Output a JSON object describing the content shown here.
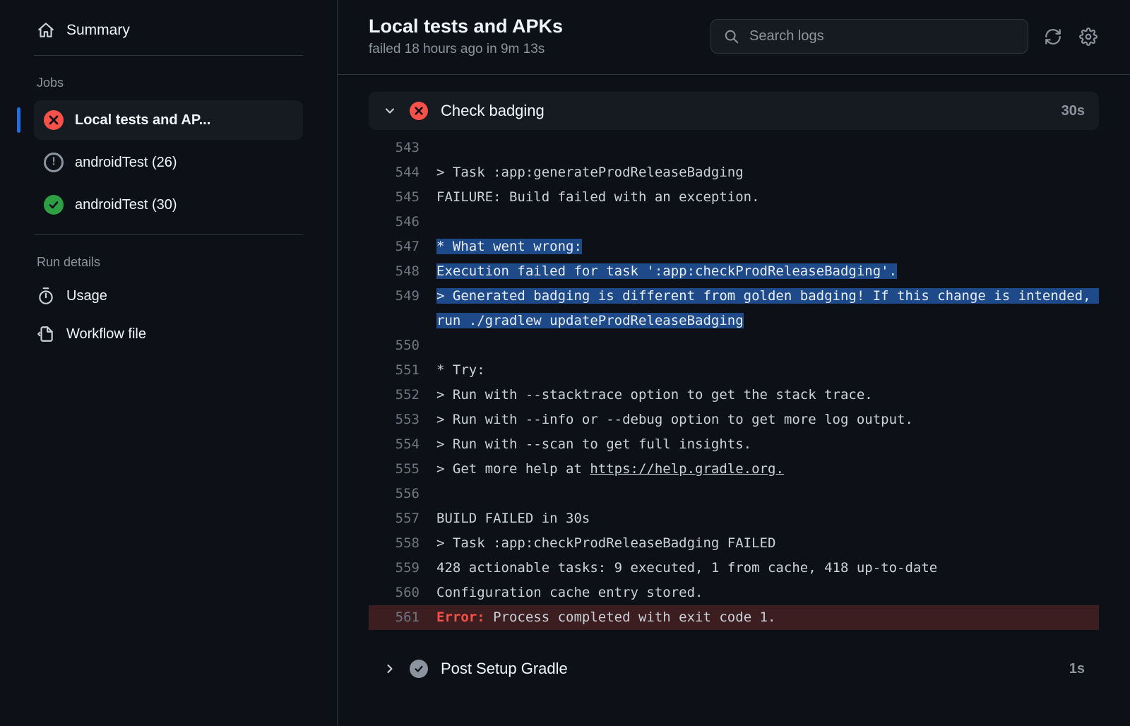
{
  "sidebar": {
    "summary_label": "Summary",
    "jobs_header": "Jobs",
    "jobs": [
      {
        "label": "Local tests and AP...",
        "status": "fail",
        "active": true
      },
      {
        "label": "androidTest (26)",
        "status": "pending",
        "active": false
      },
      {
        "label": "androidTest (30)",
        "status": "pass",
        "active": false
      }
    ],
    "run_details_header": "Run details",
    "run_details": [
      {
        "label": "Usage"
      },
      {
        "label": "Workflow file"
      }
    ]
  },
  "header": {
    "title": "Local tests and APKs",
    "subtitle": "failed 18 hours ago in 9m 13s"
  },
  "search": {
    "placeholder": "Search logs"
  },
  "step_expanded": {
    "name": "Check badging",
    "duration": "30s"
  },
  "log_lines": [
    {
      "n": "543",
      "t": ""
    },
    {
      "n": "544",
      "t": "> Task :app:generateProdReleaseBadging"
    },
    {
      "n": "545",
      "t": "FAILURE: Build failed with an exception."
    },
    {
      "n": "546",
      "t": ""
    },
    {
      "n": "547",
      "t": "* What went wrong:",
      "sel": true
    },
    {
      "n": "548",
      "t": "Execution failed for task ':app:checkProdReleaseBadging'.",
      "sel": true
    },
    {
      "n": "549",
      "t": "> Generated badging is different from golden badging! If this change is intended, run ./gradlew updateProdReleaseBadging",
      "sel": true
    },
    {
      "n": "550",
      "t": ""
    },
    {
      "n": "551",
      "t": "* Try:"
    },
    {
      "n": "552",
      "t": "> Run with --stacktrace option to get the stack trace."
    },
    {
      "n": "553",
      "t": "> Run with --info or --debug option to get more log output."
    },
    {
      "n": "554",
      "t": "> Run with --scan to get full insights."
    },
    {
      "n": "555",
      "t": "> Get more help at ",
      "link": "https://help.gradle.org."
    },
    {
      "n": "556",
      "t": ""
    },
    {
      "n": "557",
      "t": "BUILD FAILED in 30s"
    },
    {
      "n": "558",
      "t": "> Task :app:checkProdReleaseBadging FAILED"
    },
    {
      "n": "559",
      "t": "428 actionable tasks: 9 executed, 1 from cache, 418 up-to-date"
    },
    {
      "n": "560",
      "t": "Configuration cache entry stored."
    },
    {
      "n": "561",
      "err": true,
      "err_label": "Error:",
      "t": " Process completed with exit code 1."
    }
  ],
  "step_collapsed": {
    "name": "Post Setup Gradle",
    "duration": "1s"
  }
}
